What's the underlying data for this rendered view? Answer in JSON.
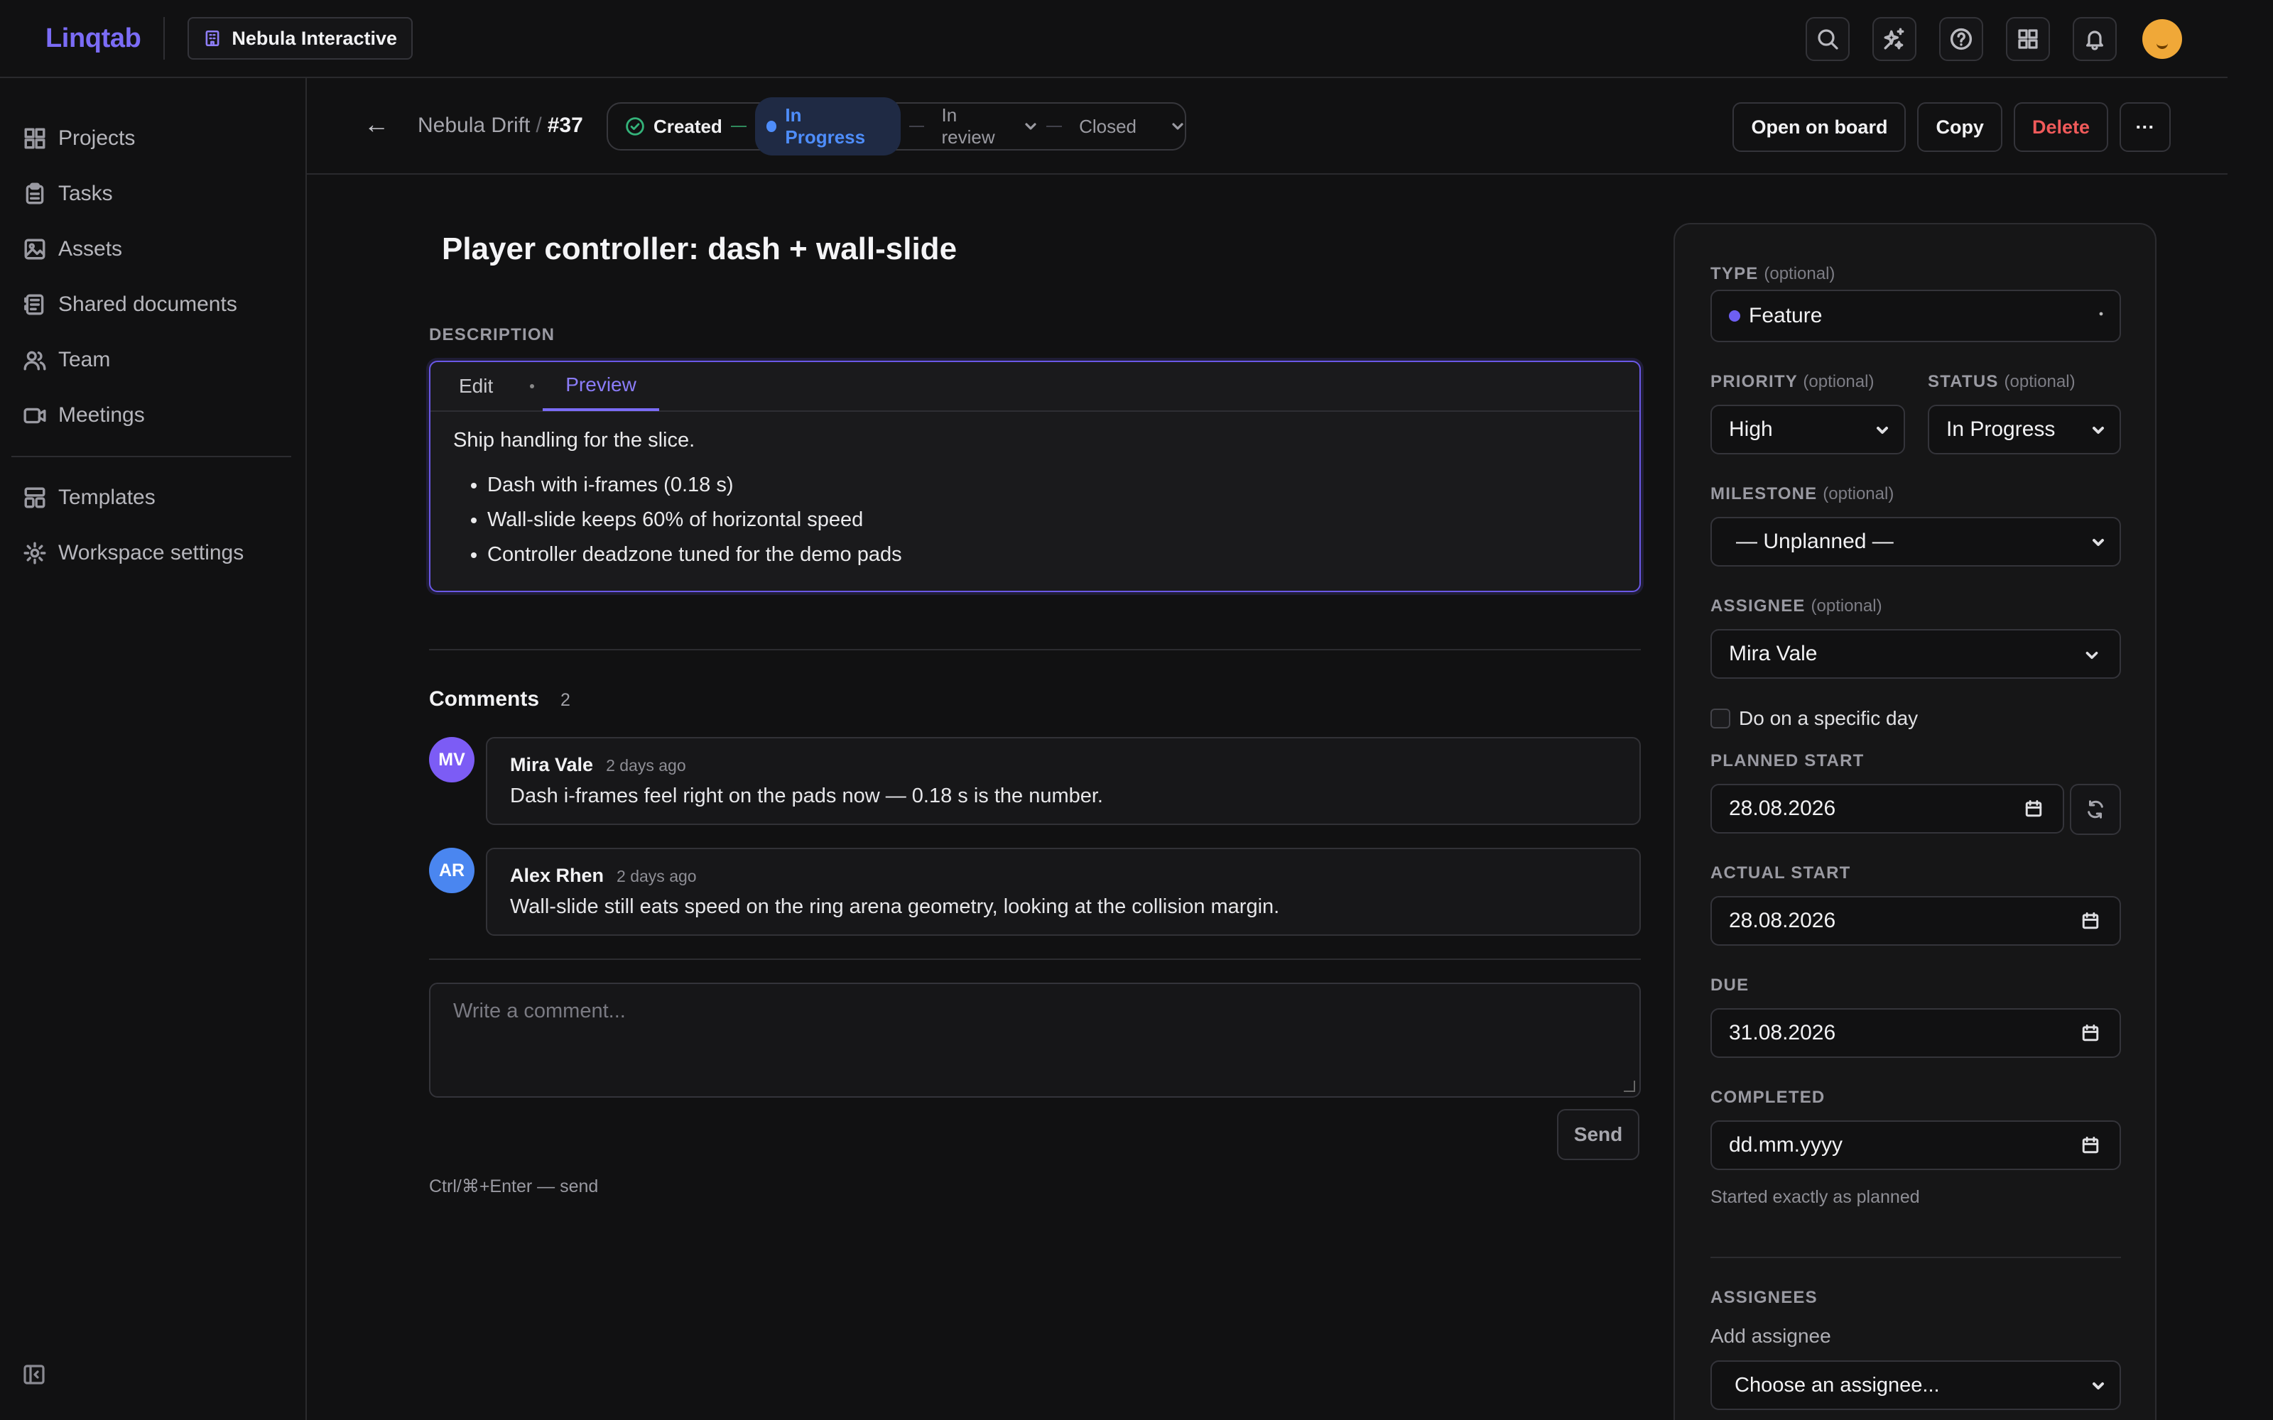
{
  "app": {
    "logo": "Linqtab",
    "workspace": "Nebula Interactive"
  },
  "sidebar": {
    "items": [
      {
        "label": "Projects",
        "icon": "grid-icon"
      },
      {
        "label": "Tasks",
        "icon": "clipboard-icon"
      },
      {
        "label": "Assets",
        "icon": "image-icon"
      },
      {
        "label": "Shared documents",
        "icon": "document-icon"
      },
      {
        "label": "Team",
        "icon": "users-icon"
      },
      {
        "label": "Meetings",
        "icon": "video-icon"
      }
    ],
    "secondary": [
      {
        "label": "Templates",
        "icon": "template-icon"
      },
      {
        "label": "Workspace settings",
        "icon": "gear-icon"
      }
    ]
  },
  "header": {
    "back": "←",
    "project": "Nebula Drift",
    "separator": "/",
    "task_number": "#37",
    "statuses": {
      "created": "Created",
      "in_progress": "In Progress",
      "in_review": "In review",
      "closed": "Closed"
    },
    "actions": {
      "open_board": "Open on board",
      "copy": "Copy",
      "delete": "Delete",
      "more": "···"
    }
  },
  "task": {
    "title": "Player controller: dash + wall-slide",
    "description_label": "DESCRIPTION",
    "tabs": {
      "edit": "Edit",
      "preview": "Preview"
    },
    "description": {
      "intro": "Ship handling for the slice.",
      "bullets": [
        "Dash with i-frames (0.18 s)",
        "Wall-slide keeps 60% of horizontal speed",
        "Controller deadzone tuned for the demo pads"
      ]
    }
  },
  "comments": {
    "title": "Comments",
    "count": "2",
    "items": [
      {
        "initials": "MV",
        "author": "Mira Vale",
        "time": "2 days ago",
        "text": "Dash i-frames feel right on the pads now — 0.18 s is the number.",
        "color": "#7c5cf5"
      },
      {
        "initials": "AR",
        "author": "Alex Rhen",
        "time": "2 days ago",
        "text": "Wall-slide still eats speed on the ring arena geometry, looking at the collision margin.",
        "color": "#4a86f0"
      }
    ],
    "placeholder": "Write a comment...",
    "send": "Send",
    "hint": "Ctrl/⌘+Enter — send"
  },
  "panel": {
    "type": {
      "label": "TYPE",
      "optional": "(optional)",
      "value": "Feature"
    },
    "priority": {
      "label": "PRIORITY",
      "optional": "(optional)",
      "value": "High"
    },
    "status": {
      "label": "STATUS",
      "optional": "(optional)",
      "value": "In Progress"
    },
    "milestone": {
      "label": "MILESTONE",
      "optional": "(optional)",
      "value": "— Unplanned —"
    },
    "assignee": {
      "label": "ASSIGNEE",
      "optional": "(optional)",
      "value": "Mira Vale"
    },
    "specific_day": "Do on a specific day",
    "planned_start": {
      "label": "PLANNED START",
      "value": "28.08.2026"
    },
    "actual_start": {
      "label": "ACTUAL START",
      "value": "28.08.2026"
    },
    "due": {
      "label": "DUE",
      "value": "31.08.2026"
    },
    "completed": {
      "label": "COMPLETED",
      "value": "dd.mm.yyyy"
    },
    "note": "Started exactly as planned",
    "assignees": {
      "label": "ASSIGNEES",
      "add": "Add assignee",
      "choose": "Choose an assignee..."
    }
  },
  "colors": {
    "accent": "#7b6cf6",
    "in_progress": "#4e8dfb",
    "danger": "#f05a5a",
    "background": "#111112"
  }
}
